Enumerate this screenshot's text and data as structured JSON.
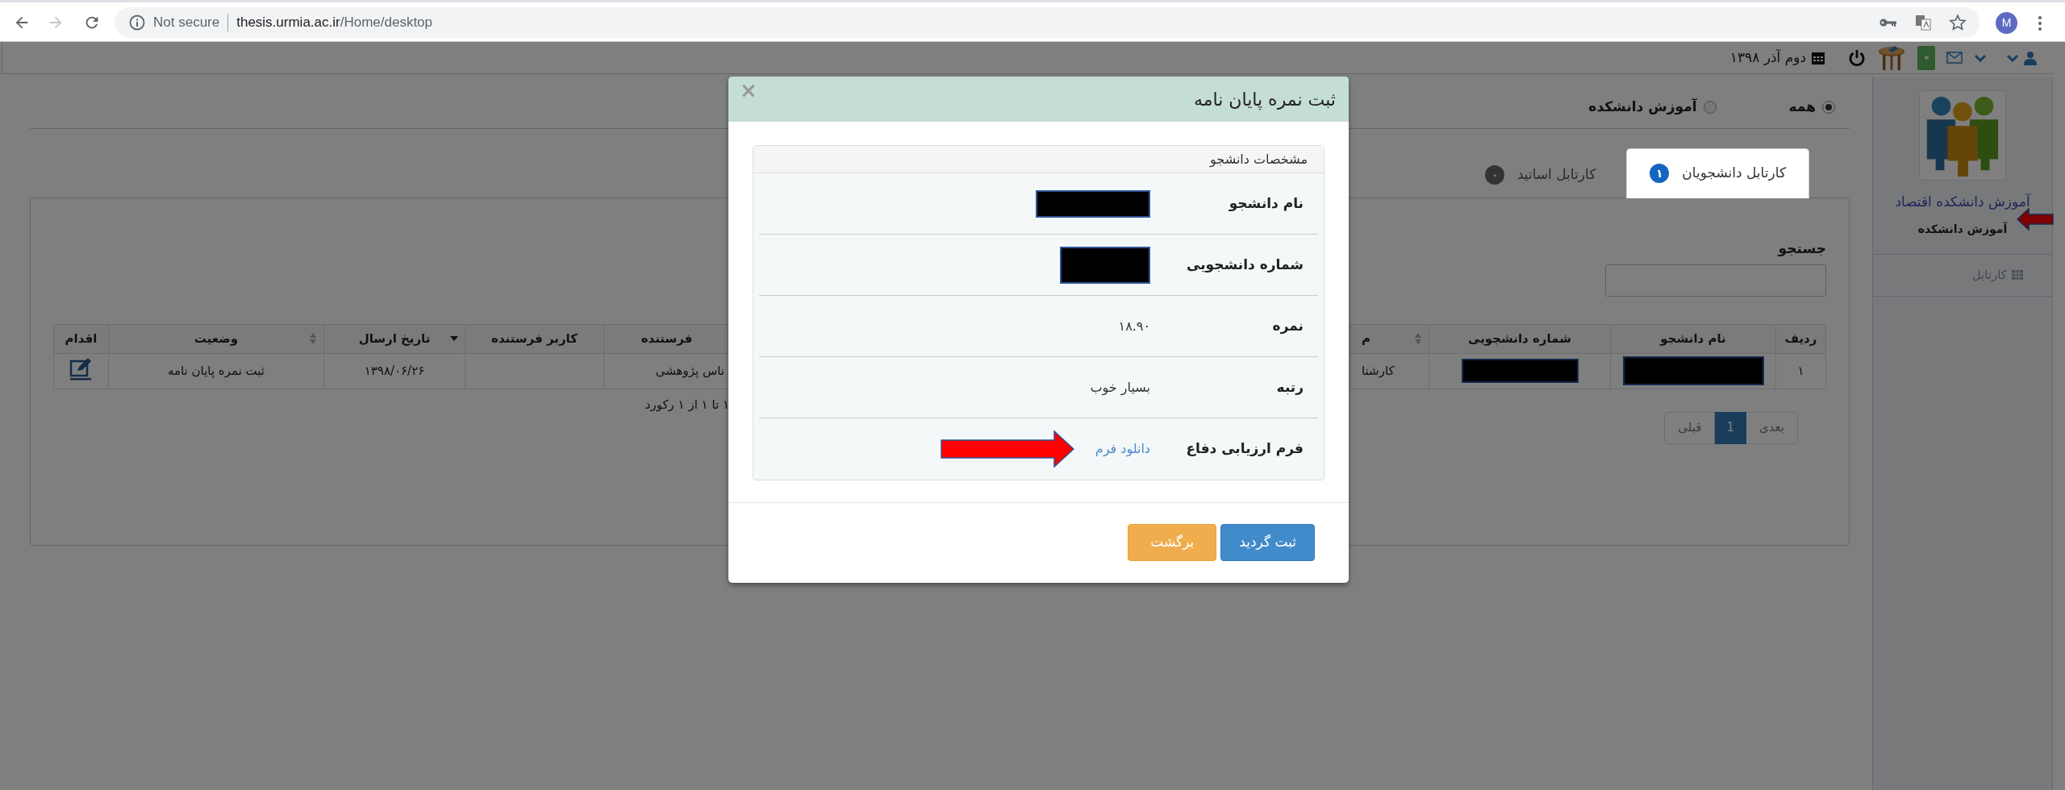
{
  "browser": {
    "forward_disabled": true,
    "security_label": "Not secure",
    "url_host": "thesis.urmia.ac.ir",
    "url_path": "/Home/desktop",
    "profile_initial": "M"
  },
  "header": {
    "date": "دوم آذر ۱۳۹۸"
  },
  "sidebar": {
    "unit_title": "آموزش دانشکده اقتصاد",
    "role": "آموزش دانشکده",
    "items": [
      {
        "label": "کارتابل"
      }
    ]
  },
  "filter": [
    {
      "label": "همه",
      "selected": true
    },
    {
      "label": "آموزش دانشکده",
      "selected": false
    }
  ],
  "tabs": [
    {
      "label": "کارتابل دانشجویان",
      "badge": "۱",
      "selected": true
    },
    {
      "label": "کارتابل اساتید",
      "badge": "۰",
      "selected": false
    }
  ],
  "search": {
    "label": "جستجو"
  },
  "table": {
    "columns": [
      {
        "label": "ردیف",
        "sortable": false,
        "sorted_desc": false
      },
      {
        "label": "نام دانشجو",
        "sortable": false,
        "sorted_desc": false
      },
      {
        "label": "شماره دانشجویی",
        "sortable": false,
        "sorted_desc": false
      },
      {
        "label": "م",
        "sortable": true,
        "sorted_desc": false
      },
      {
        "label": "فرستنده",
        "sortable": false,
        "sorted_desc": false
      },
      {
        "label": "کاربر فرستنده",
        "sortable": false,
        "sorted_desc": false
      },
      {
        "label": "تاریخ ارسال",
        "sortable": false,
        "sorted_desc": true
      },
      {
        "label": "وضعیت",
        "sortable": true,
        "sorted_desc": false
      },
      {
        "label": "اقدام",
        "sortable": false,
        "sorted_desc": false
      }
    ],
    "rows": [
      {
        "cells": [
          {
            "kind": "text",
            "text": "۱"
          },
          {
            "kind": "redacted"
          },
          {
            "kind": "redacted"
          },
          {
            "kind": "text",
            "text": "کارشنا"
          },
          {
            "kind": "text",
            "text": "ناس پژوهشی"
          },
          {
            "kind": "empty"
          },
          {
            "kind": "text",
            "text": "۱۳۹۸/۰۶/۲۶"
          },
          {
            "kind": "text",
            "text": "ثبت نمره پایان نامه"
          },
          {
            "kind": "edit"
          }
        ]
      }
    ]
  },
  "record_info": "۱ تا ۱ از ۱ رکورد",
  "pagination": [
    {
      "label": "بعدی",
      "selected": false
    },
    {
      "label": "1",
      "selected": true
    },
    {
      "label": "قبلی",
      "selected": false
    }
  ],
  "modal": {
    "title": "ثبت نمره پایان نامه",
    "close": "×",
    "panel_title": "مشخصات دانشجو",
    "fields": [
      {
        "label": "نام دانشجو",
        "kind": "redacted"
      },
      {
        "label": "شماره دانشجویی",
        "kind": "redacted"
      },
      {
        "label": "نمره",
        "kind": "text",
        "value": "۱۸.۹۰"
      },
      {
        "label": "رتبه",
        "kind": "text",
        "value": "بسیار خوب"
      },
      {
        "label": "فرم ارزیابی دفاع",
        "kind": "link",
        "value": "دانلود فرم"
      }
    ],
    "buttons": [
      {
        "label": "ثبت گردید",
        "kind": "primary"
      },
      {
        "label": "برگشت",
        "kind": "warning"
      }
    ]
  }
}
